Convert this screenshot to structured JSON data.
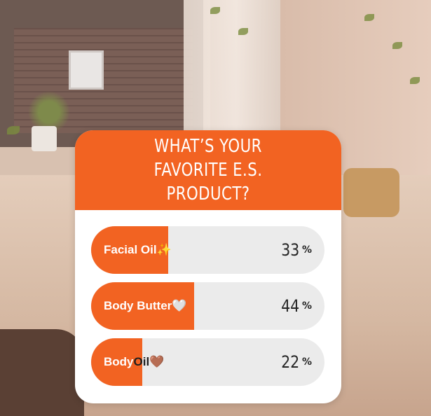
{
  "poll": {
    "question": "WHAT’S YOUR FAVORITE E.S. PRODUCT?",
    "accent_color": "#f26322",
    "options": [
      {
        "label": "Facial Oil",
        "emoji": "✨",
        "percent": 33,
        "percent_text": "33",
        "sign": "%"
      },
      {
        "label": "Body Butter",
        "emoji": "🤍",
        "percent": 44,
        "percent_text": "44",
        "sign": "%"
      },
      {
        "label_light": "Body ",
        "label_dark": "Oil",
        "emoji": "🤎",
        "percent": 22,
        "percent_text": "22",
        "sign": "%"
      }
    ]
  }
}
